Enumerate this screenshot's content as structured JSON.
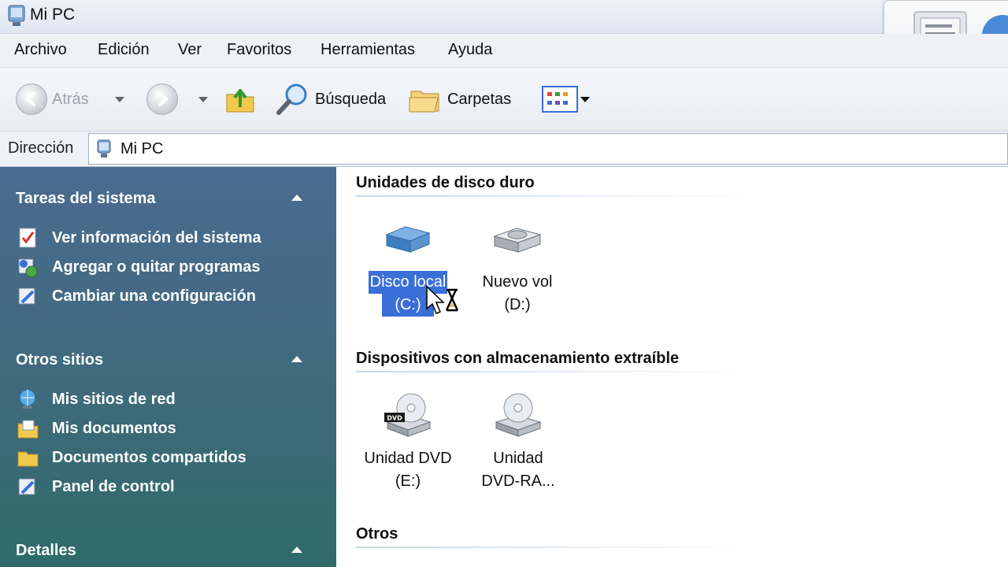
{
  "window": {
    "title": "Mi PC"
  },
  "menu": [
    "Archivo",
    "Edición",
    "Ver",
    "Favoritos",
    "Herramientas",
    "Ayuda"
  ],
  "toolbar": {
    "back_label": "Atrás",
    "search_label": "Búsqueda",
    "folders_label": "Carpetas"
  },
  "address": {
    "label": "Dirección",
    "value": "Mi PC"
  },
  "sidebar": {
    "system_tasks": {
      "title": "Tareas del sistema",
      "items": [
        "Ver información del sistema",
        "Agregar o quitar programas",
        "Cambiar una configuración"
      ]
    },
    "other_places": {
      "title": "Otros sitios",
      "items": [
        "Mis sitios de red",
        "Mis documentos",
        "Documentos compartidos",
        "Panel de control"
      ]
    },
    "details": {
      "title": "Detalles"
    }
  },
  "content": {
    "hard_drives": {
      "title": "Unidades de disco duro",
      "items": [
        {
          "line1": "Disco local",
          "line2": "(C:)",
          "selected": true
        },
        {
          "line1": "Nuevo vol",
          "line2": "(D:)",
          "selected": false
        }
      ]
    },
    "removable": {
      "title": "Dispositivos con almacenamiento extraíble",
      "items": [
        {
          "line1": "Unidad DVD",
          "line2": "(E:)",
          "badge": "DVD"
        },
        {
          "line1": "Unidad",
          "line2": "DVD-RA..."
        }
      ]
    },
    "others": {
      "title": "Otros"
    }
  },
  "colors": {
    "selection": "#3a6fd8",
    "sidebar_top": "#4a6b90",
    "sidebar_bottom": "#2f6b6a"
  }
}
